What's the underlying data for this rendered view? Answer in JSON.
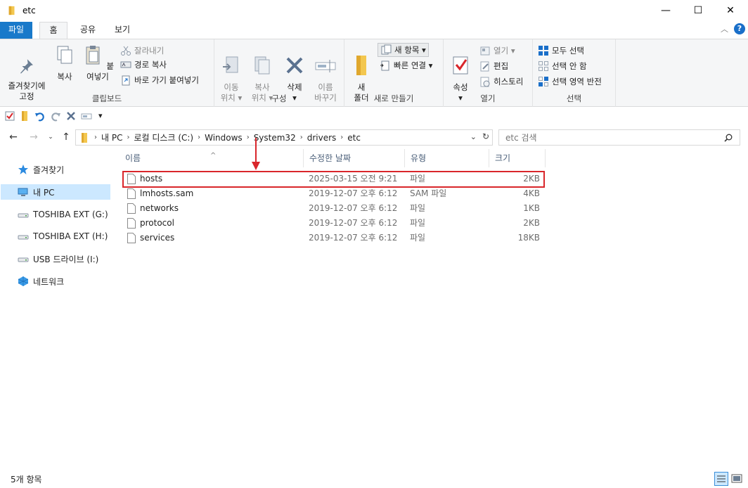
{
  "window": {
    "title": "etc",
    "minimize": "—",
    "maximize": "☐",
    "close": "✕"
  },
  "tabs": {
    "file": "파일",
    "home": "홈",
    "share": "공유",
    "view": "보기"
  },
  "ribbon": {
    "clipboard": {
      "pin": "즐겨찾기에\n고정",
      "copy": "복사",
      "paste": "붙여넣기",
      "cut": "잘라내기",
      "copy_path": "경로 복사",
      "paste_shortcut": "바로 가기 붙여넣기",
      "label": "클립보드"
    },
    "organize": {
      "move_to": "이동\n위치 ▾",
      "copy_to": "복사\n위치 ▾",
      "delete": "삭제\n▾",
      "rename": "이름\n바꾸기",
      "label": "구성"
    },
    "new": {
      "new_folder": "새\n폴더",
      "new_item": "새 항목 ▾",
      "easy_access": "빠른 연결 ▾",
      "label": "새로 만들기"
    },
    "open": {
      "properties": "속성\n▾",
      "open": "열기 ▾",
      "edit": "편집",
      "history": "히스토리",
      "label": "열기"
    },
    "select": {
      "select_all": "모두 선택",
      "select_none": "선택 안 함",
      "invert": "선택 영역 반전",
      "label": "선택"
    }
  },
  "address": {
    "crumbs": [
      "내 PC",
      "로컬 디스크 (C:)",
      "Windows",
      "System32",
      "drivers",
      "etc"
    ],
    "search_placeholder": "etc 검색"
  },
  "nav": {
    "items": [
      {
        "label": "즐겨찾기"
      },
      {
        "label": "내 PC"
      },
      {
        "label": "TOSHIBA EXT (G:)"
      },
      {
        "label": "TOSHIBA EXT (H:)"
      },
      {
        "label": "USB 드라이브 (I:)"
      },
      {
        "label": "네트워크"
      }
    ]
  },
  "columns": {
    "name": "이름",
    "date": "수정한 날짜",
    "type": "유형",
    "size": "크기"
  },
  "files": [
    {
      "name": "hosts",
      "date": "2025-03-15 오전 9:21",
      "type": "파일",
      "size": "2KB"
    },
    {
      "name": "lmhosts.sam",
      "date": "2019-12-07 오후 6:12",
      "type": "SAM 파일",
      "size": "4KB"
    },
    {
      "name": "networks",
      "date": "2019-12-07 오후 6:12",
      "type": "파일",
      "size": "1KB"
    },
    {
      "name": "protocol",
      "date": "2019-12-07 오후 6:12",
      "type": "파일",
      "size": "2KB"
    },
    {
      "name": "services",
      "date": "2019-12-07 오후 6:12",
      "type": "파일",
      "size": "18KB"
    }
  ],
  "status": {
    "count": "5개 항목"
  },
  "colors": {
    "accent": "#1979ca",
    "highlight": "#d9262b",
    "selected": "#cce8ff",
    "folder": "#f3c74f"
  }
}
